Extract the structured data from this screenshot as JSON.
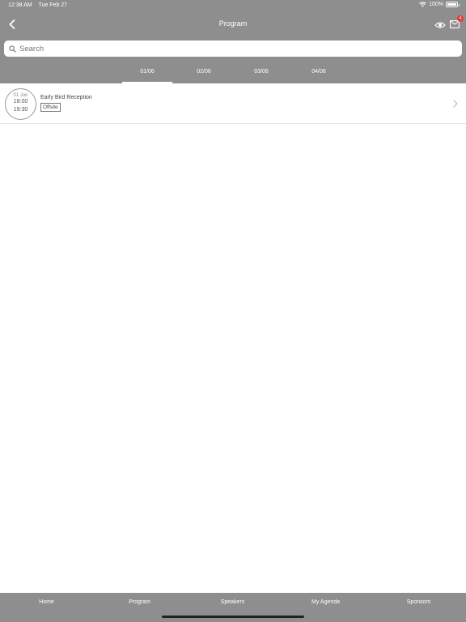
{
  "status_bar": {
    "time": "12:38 AM",
    "date": "Tue Feb 27",
    "battery": "100%",
    "battery_level": 1.0
  },
  "nav": {
    "title": "Program",
    "back_icon": "chevron-left-icon",
    "mail_badge": "4"
  },
  "search": {
    "placeholder": "Search"
  },
  "tabs": [
    {
      "label": "01/06",
      "active": true
    },
    {
      "label": "02/06",
      "active": false
    },
    {
      "label": "03/06",
      "active": false
    },
    {
      "label": "04/06",
      "active": false
    }
  ],
  "sessions": [
    {
      "day": "01 Jun",
      "start": "18:00",
      "end": "19:30",
      "title": "Early Bird Reception",
      "tag": "Offsite"
    }
  ],
  "tab_bar": {
    "items": [
      "Home",
      "Program",
      "Speakers",
      "My Agenda",
      "Sponsors"
    ]
  },
  "colors": {
    "header_bg": "#8e8e8e",
    "badge": "#e53935"
  }
}
